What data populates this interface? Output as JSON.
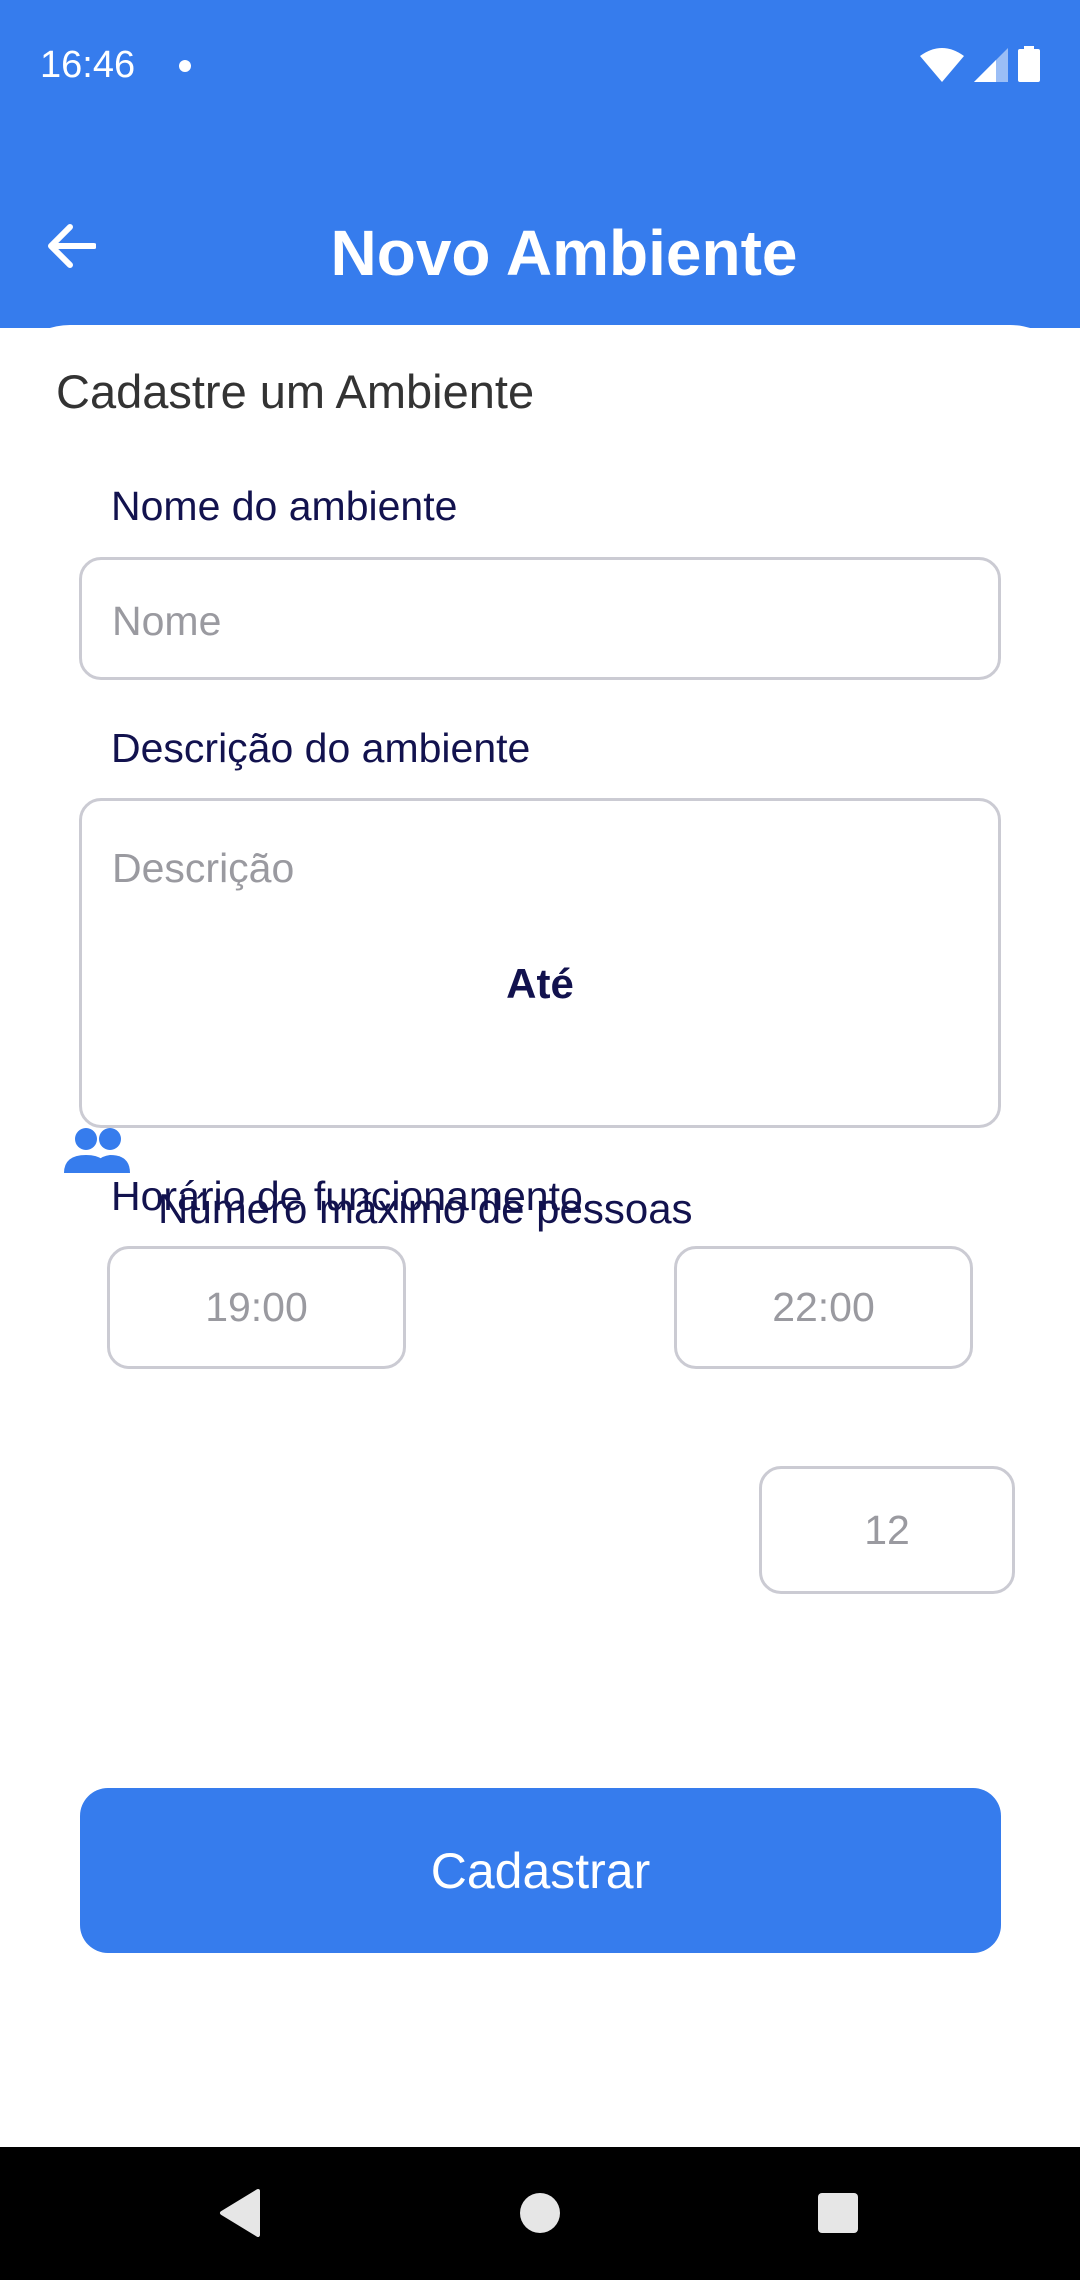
{
  "status_bar": {
    "time": "16:46",
    "icons": [
      "wifi-icon",
      "signal-icon",
      "battery-icon"
    ]
  },
  "app_bar": {
    "title": "Novo Ambiente",
    "back_icon": "arrow-left-icon"
  },
  "form": {
    "section_title": "Cadastre um Ambiente",
    "name_label": "Nome do ambiente",
    "name_placeholder": "Nome",
    "description_label": "Descrição do ambiente",
    "description_placeholder": "Descrição",
    "hours_label": "Horário de funcionamento",
    "start_time_placeholder": "19:00",
    "until_label": "Até",
    "end_time_placeholder": "22:00",
    "max_people_icon": "people-icon",
    "max_people_label": "Número máximo de pessoas",
    "max_people_placeholder": "12",
    "submit_label": "Cadastrar"
  },
  "nav_bar": {
    "icons": [
      "back-triangle-icon",
      "home-circle-icon",
      "recents-square-icon"
    ]
  },
  "colors": {
    "primary": "#367CED",
    "label": "#12124E",
    "placeholder": "#9A9AA0",
    "border": "#CBCBD3"
  }
}
